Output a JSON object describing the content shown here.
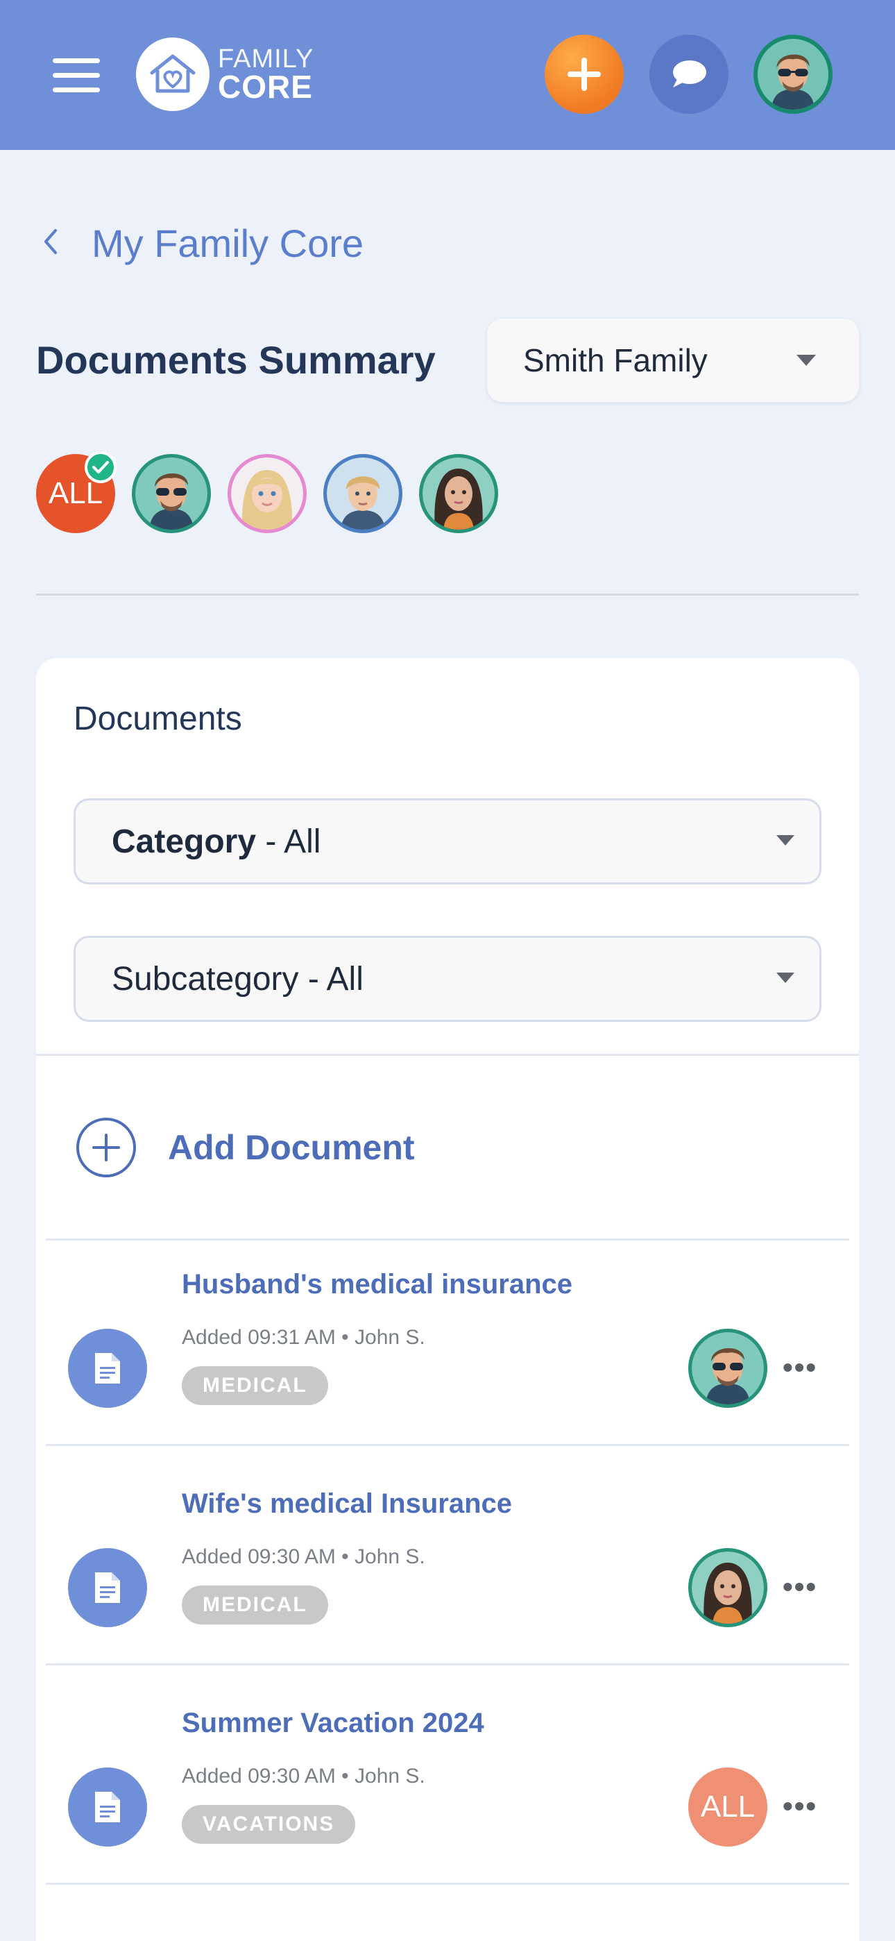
{
  "header": {
    "logo_line1": "FAMILY",
    "logo_line2": "CORE",
    "menu_icon": "hamburger-menu-icon",
    "add_icon": "plus-icon",
    "chat_icon": "chat-bubble-icon",
    "colors": {
      "bar": "#6f8fd8",
      "add": "#f07a24",
      "chat": "#5b77c8"
    }
  },
  "breadcrumb": {
    "label": "My Family Core",
    "back_icon": "chevron-left-icon"
  },
  "summary": {
    "title": "Documents Summary",
    "family_select": "Smith Family"
  },
  "members": [
    {
      "label": "ALL",
      "selected": true
    },
    {
      "name": "man with sunglasses"
    },
    {
      "name": "girl"
    },
    {
      "name": "boy"
    },
    {
      "name": "woman"
    }
  ],
  "documents": {
    "title": "Documents",
    "category_label": "Category",
    "category_value": " - All",
    "subcategory": "Subcategory - All",
    "add_label": "Add Document",
    "items": [
      {
        "title": "Husband's medical insurance",
        "meta": "Added 09:31 AM • John S.",
        "tag": "MEDICAL",
        "owner": "man"
      },
      {
        "title": "Wife's medical Insurance",
        "meta": "Added 09:30 AM • John S.",
        "tag": "MEDICAL",
        "owner": "woman"
      },
      {
        "title": "Summer Vacation 2024",
        "meta": "Added 09:30 AM • John S.",
        "tag": "VACATIONS",
        "owner": "ALL"
      }
    ],
    "more_label": "•••"
  }
}
